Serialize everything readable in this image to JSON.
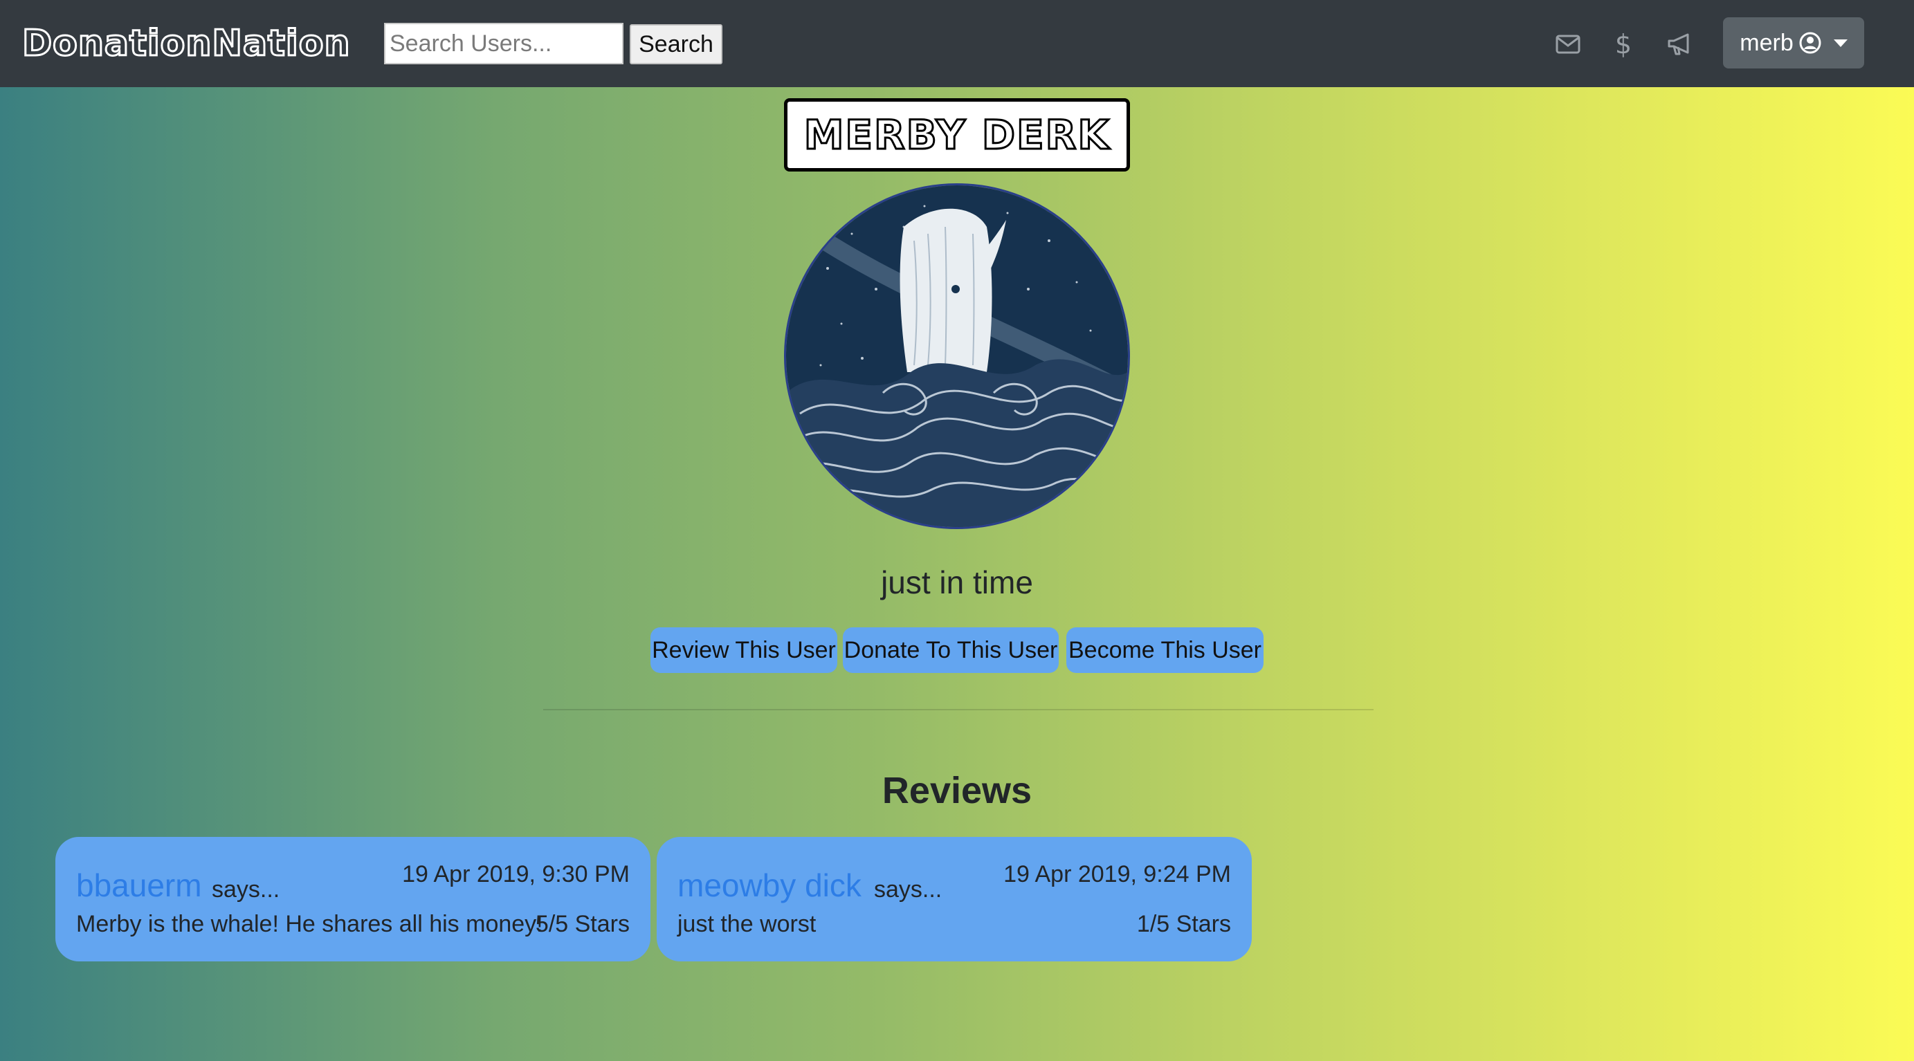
{
  "navbar": {
    "brand": "DonationNation",
    "search": {
      "placeholder": "Search Users...",
      "value": ""
    },
    "search_button_label": "Search",
    "icons": [
      "envelope-icon",
      "dollar-icon",
      "megaphone-icon"
    ],
    "user_menu": {
      "label": "merb",
      "icon": "user-circle-icon"
    }
  },
  "profile": {
    "display_name": "MERBY DERK",
    "avatar": "whale-illustration",
    "tagline": "just in time",
    "actions": [
      {
        "label": "Review This User"
      },
      {
        "label": "Donate To This User"
      },
      {
        "label": "Become This User"
      }
    ]
  },
  "reviews": {
    "heading": "Reviews",
    "items": [
      {
        "reviewer": "bbauerm",
        "says": "says...",
        "date": "19 Apr 2019, 9:30 PM",
        "text": "Merby is the whale! He shares all his money!",
        "stars": "5/5 Stars"
      },
      {
        "reviewer": "meowby dick",
        "says": "says...",
        "date": "19 Apr 2019, 9:24 PM",
        "text": "just the worst",
        "stars": "1/5 Stars"
      }
    ]
  },
  "colors": {
    "navbar_bg": "#343a40",
    "button_blue": "#63a5f0",
    "link_blue": "#2d7de6",
    "gradient_start": "#3b8081",
    "gradient_end": "#fbfb55"
  }
}
